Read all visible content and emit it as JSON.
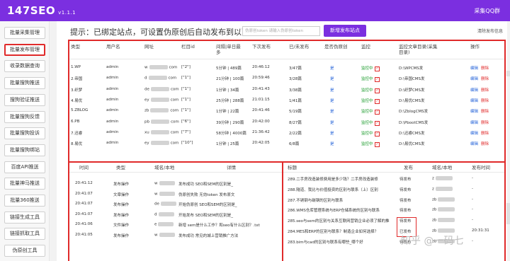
{
  "app": {
    "name": "147SEO",
    "version": "v1.1.1",
    "qq_label": "采集QQ群"
  },
  "sidebar": {
    "items": [
      "批量采集管理",
      "批量发布管理",
      "收录数据查询",
      "批量搜狗推送",
      "搜狗验证推送",
      "批量搜狗反馈",
      "批量搜狗投诉",
      "批量搜狗绑站",
      "百度API推送",
      "批量神马推送",
      "批量360推送",
      "链接生成工具",
      "链接抓取工具",
      "伪原创工具"
    ]
  },
  "main": {
    "tip": "提示：已绑定站点，可设置伪原创后自动发布到以下站点",
    "search_placeholder": "伪原创token 请输入伪原创token",
    "add_button": "新增发布站点",
    "clear_link": "清除发布信息"
  },
  "sites": {
    "headers": [
      "类型",
      "用户名",
      "网址",
      "栏目id",
      "间隔|单日最多",
      "下次发布",
      "已/未发布",
      "是否伪原创",
      "监控",
      "监控文章目录(采集目录)",
      "操作"
    ],
    "rows": [
      {
        "type": "1.WP",
        "user": "admin",
        "url": "com",
        "col": "[\"2\"]",
        "interval": "5分钟 | 489篇",
        "next": "20:46:12",
        "count": "3/47篇",
        "pseudo": "是",
        "monitor": "监控中",
        "dir": "D:\\WPCMS发",
        "edit": "编辑",
        "del": "删除",
        "url_prefix": "w"
      },
      {
        "type": "2.帝国",
        "user": "admin",
        "url": "com",
        "col": "[\"1\"]",
        "interval": "21分钟 | 100篇",
        "next": "20:59:46",
        "count": "3/28篇",
        "pseudo": "是",
        "monitor": "监控中",
        "dir": "D:\\帝国CMS发",
        "edit": "编辑",
        "del": "删除",
        "url_prefix": "d"
      },
      {
        "type": "3.织梦",
        "user": "admin",
        "url": "com",
        "col": "[\"1\"]",
        "interval": "1分钟 | 34篇",
        "next": "20:41:43",
        "count": "3/38篇",
        "pseudo": "是",
        "monitor": "监控中",
        "dir": "D:\\织梦CMS发",
        "edit": "编辑",
        "del": "删除",
        "url_prefix": "de"
      },
      {
        "type": "4.易优",
        "user": "admin",
        "url": "com",
        "col": "[\"1\"]",
        "interval": "25分钟 | 288篇",
        "next": "21:01:15",
        "count": "1/41篇",
        "pseudo": "是",
        "monitor": "监控中",
        "dir": "D:\\易优CMS发",
        "edit": "编辑",
        "del": "删除",
        "url_prefix": "ey"
      },
      {
        "type": "5.ZBLOG",
        "user": "admin",
        "url": "com",
        "col": "[\"1\"]",
        "interval": "1分钟 | 22篇",
        "next": "20:41:46",
        "count": "5/19篇",
        "pseudo": "是",
        "monitor": "监控中",
        "dir": "D:\\ZblogCMS发",
        "edit": "编辑",
        "del": "删除",
        "url_prefix": "zb"
      },
      {
        "type": "6.PB",
        "user": "admin",
        "url": "com",
        "col": "[\"6\"]",
        "interval": "39分钟 | 290篇",
        "next": "20:42:00",
        "count": "8/27篇",
        "pseudo": "是",
        "monitor": "监控中",
        "dir": "D:\\PbootCMS发",
        "edit": "编辑",
        "del": "删除",
        "url_prefix": "pb"
      },
      {
        "type": "7.迅睿",
        "user": "admin",
        "url": "com",
        "col": "[\"7\"]",
        "interval": "58分钟 | 4000篇",
        "next": "21:36:42",
        "count": "2/22篇",
        "pseudo": "是",
        "monitor": "监控中",
        "dir": "D:\\迅睿CMS发",
        "edit": "编辑",
        "del": "删除",
        "url_prefix": "xu"
      },
      {
        "type": "8.易优",
        "user": "admin",
        "url": "com",
        "col": "[\"10\"]",
        "interval": "1分钟 | 25篇",
        "next": "20:42:05",
        "count": "6/8篇",
        "pseudo": "是",
        "monitor": "监控中",
        "dir": "D:\\易优CMS发",
        "edit": "编辑",
        "del": "删除",
        "url_prefix": "ey"
      }
    ]
  },
  "log": {
    "headers": [
      "时间",
      "类型",
      "域名/本地",
      "详情"
    ],
    "rows": [
      {
        "time": "20:41:12",
        "type": "发布操作",
        "domain": "w",
        "detail": "发布成功 SEO和SEM的区别是_"
      },
      {
        "time": "20:41:07",
        "type": "文章操作",
        "domain": "w",
        "detail": "伪原创失败 无効token 发布原文"
      },
      {
        "time": "20:41:07",
        "type": "发布操作",
        "domain": "de",
        "detail": "开始伪原创 SEO和SEM的区别是_"
      },
      {
        "time": "20:41:07",
        "type": "发布操作",
        "domain": "d",
        "detail": "开始发布 SEO和SEM的区别是_"
      },
      {
        "time": "20:41:06",
        "type": "文件操作",
        "domain": "e",
        "detail": "新增 sem是什么工作？和seo有什么区别？.txt"
      },
      {
        "time": "20:41:05",
        "type": "发布操作",
        "domain": "w",
        "detail": "发布成功 常见的城上营销推广方法"
      }
    ]
  },
  "articles": {
    "headers": [
      "标题",
      "发布",
      "域名/本地",
      "发布时间"
    ],
    "rows": [
      {
        "title": "289.二手房改造装修费用是多少钱？二手房改造装修",
        "status": "待发布",
        "domain": "z",
        "time": "-"
      },
      {
        "title": "288.隧道、我比与价值投资的区别与联系（上）区别",
        "status": "待发布",
        "domain": "z",
        "time": "-"
      },
      {
        "title": "287.不锈钢与碳钢的区别与联系",
        "status": "待发布",
        "domain": "zb",
        "time": "-"
      },
      {
        "title": "286.WMS仓库管理系统与ERP仓储系统的区别与联系",
        "status": "待发布",
        "domain": "zb",
        "time": "-"
      },
      {
        "title": "285.seo与sem的区别与关系互联网营销企业必须了解的推",
        "status": "待发布",
        "domain": "zb",
        "time": "-"
      },
      {
        "title": "284.MES和ERP的区别与联系？制造企业如何选择？",
        "status": "已发布",
        "domain": "zb",
        "time": "20:31:31"
      },
      {
        "title": "283.bim与cad的区别与联系有哪些_哪个好",
        "status": "待发布",
        "domain": "zb",
        "time": "-"
      }
    ]
  },
  "watermark": "知乎 @一码七"
}
